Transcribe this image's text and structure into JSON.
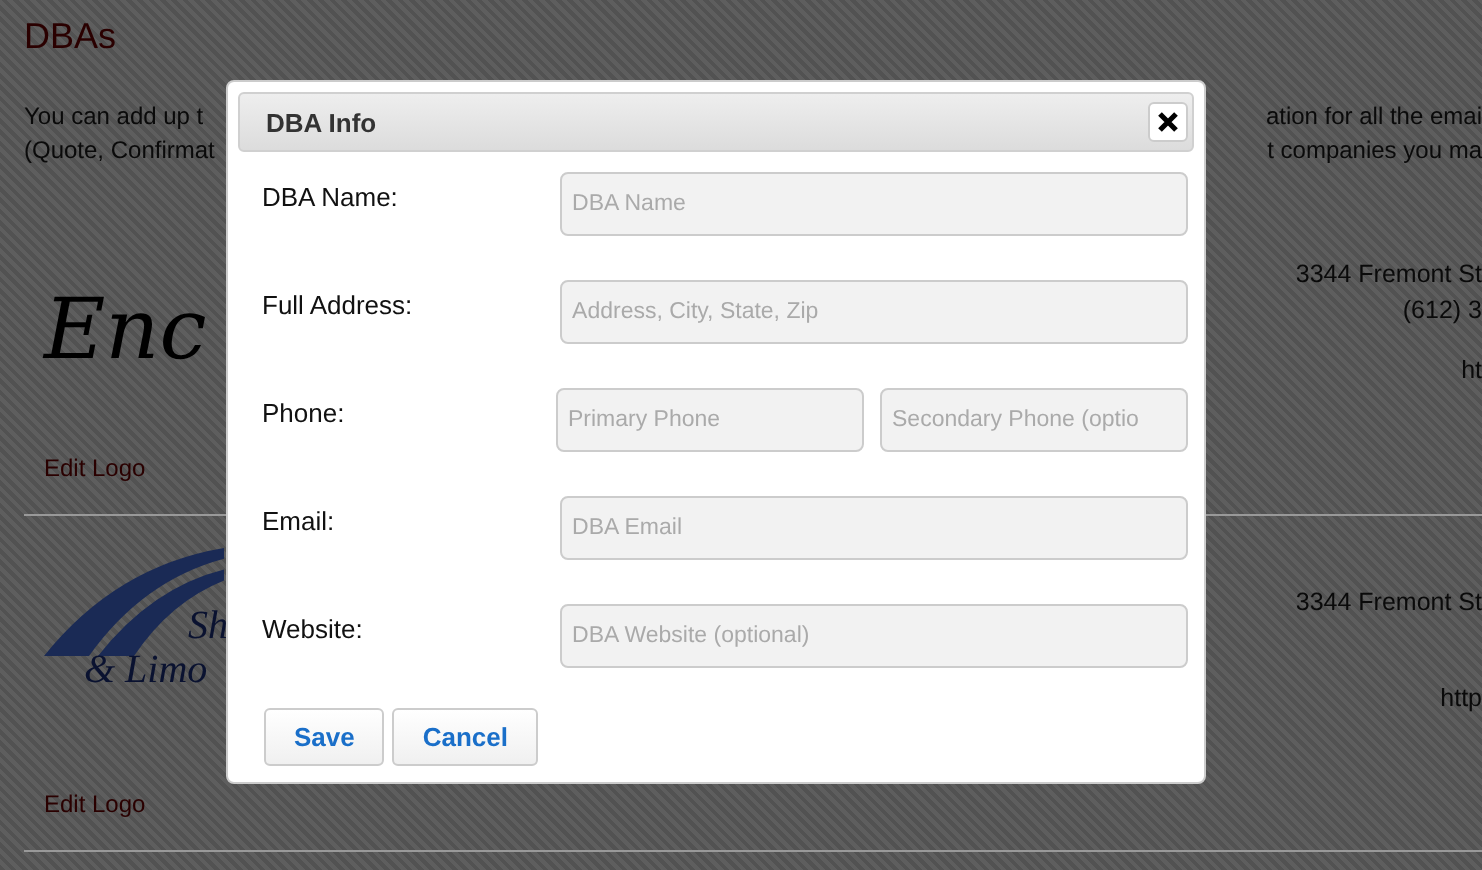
{
  "page": {
    "title": "DBAs",
    "intro_lines": [
      {
        "start": "You can add up t",
        "end": "ation for all the emai"
      },
      {
        "start": "(Quote, Confirmat",
        "end": "t companies you ma"
      }
    ],
    "dbas": [
      {
        "kind": "script",
        "logo_text": [
          "Enc"
        ],
        "address_lines": [
          "3344 Fremont St",
          "(612) 3",
          "ht"
        ],
        "edit_link": "Edit Logo"
      },
      {
        "kind": "emblem",
        "logo_text": [
          "Sh",
          "& Limo"
        ],
        "address_lines": [
          "3344 Fremont St",
          "http"
        ],
        "edit_link": "Edit Logo"
      }
    ]
  },
  "dialog": {
    "title": "DBA Info",
    "fields": [
      {
        "label": "DBA Name:",
        "inputs": [
          {
            "placeholder": "DBA Name"
          }
        ]
      },
      {
        "label": "Full Address:",
        "inputs": [
          {
            "placeholder": "Address, City, State, Zip"
          }
        ]
      },
      {
        "label": "Phone:",
        "inputs": [
          {
            "placeholder": "Primary Phone"
          },
          {
            "placeholder": "Secondary Phone (optio"
          }
        ]
      },
      {
        "label": "Email:",
        "inputs": [
          {
            "placeholder": "DBA Email"
          }
        ]
      },
      {
        "label": "Website:",
        "inputs": [
          {
            "placeholder": "DBA Website (optional)"
          }
        ]
      }
    ],
    "buttons": [
      "Save",
      "Cancel"
    ]
  }
}
